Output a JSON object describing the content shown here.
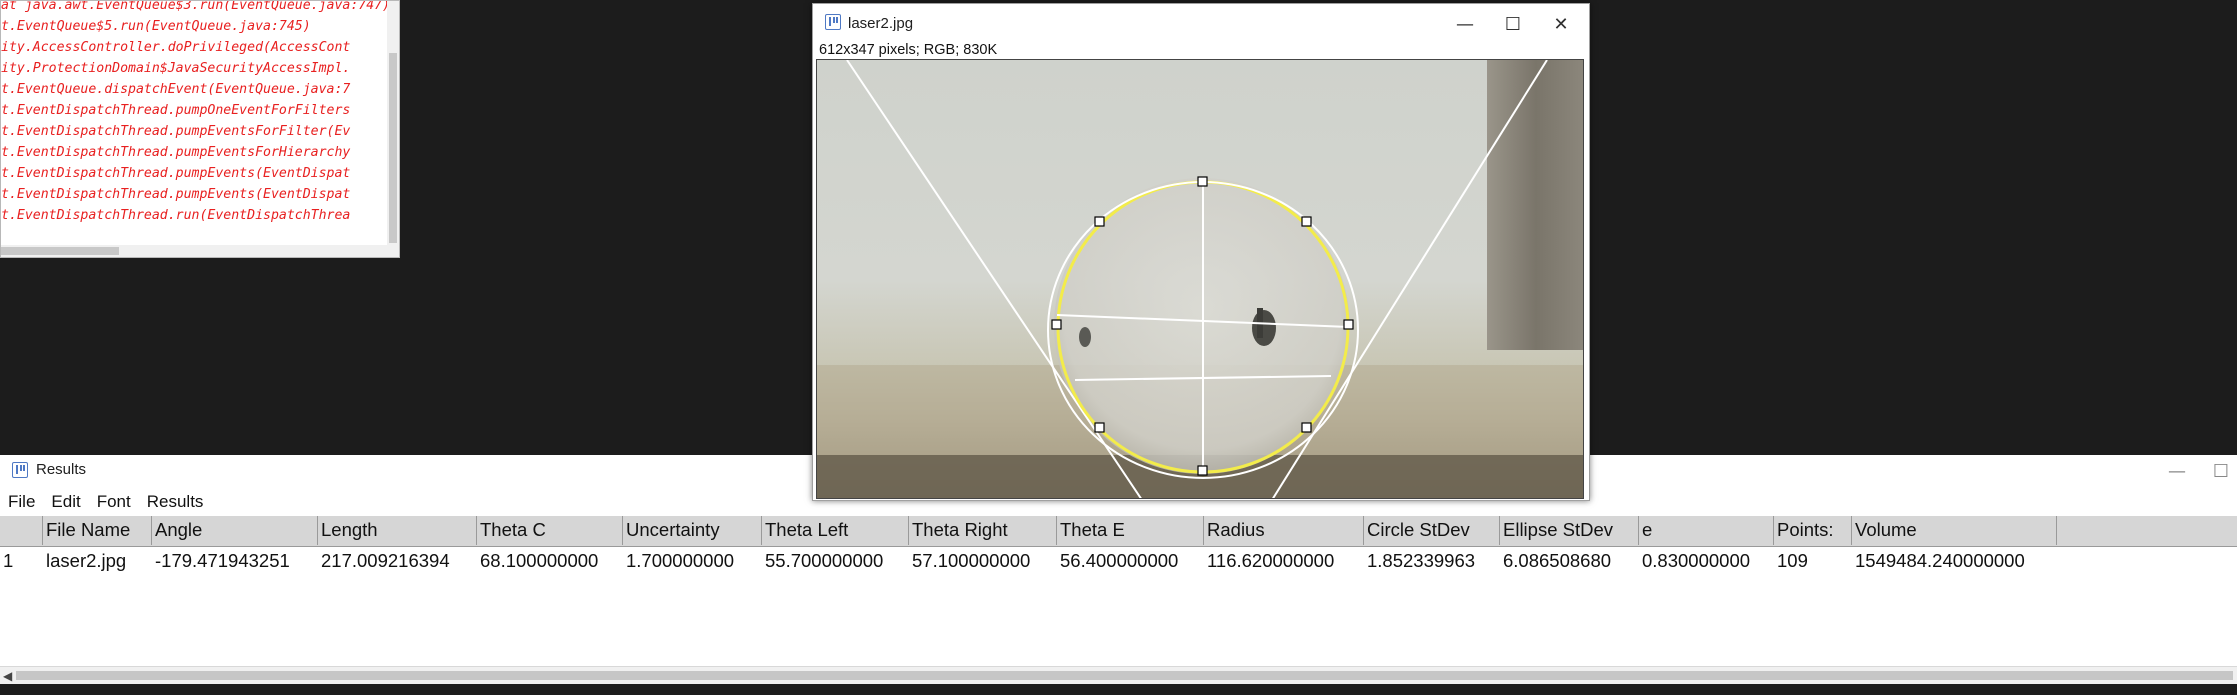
{
  "console": {
    "lines": [
      "at java.awt.EventQueue$3.run(EventQueue.java:747)",
      "t.EventQueue$5.run(EventQueue.java:745)",
      "ity.AccessController.doPrivileged(AccessCont",
      "ity.ProtectionDomain$JavaSecurityAccessImpl.",
      "t.EventQueue.dispatchEvent(EventQueue.java:7",
      "t.EventDispatchThread.pumpOneEventForFilters",
      "t.EventDispatchThread.pumpEventsForFilter(Ev",
      "t.EventDispatchThread.pumpEventsForHierarchy",
      "t.EventDispatchThread.pumpEvents(EventDispat",
      "t.EventDispatchThread.pumpEvents(EventDispat",
      "t.EventDispatchThread.run(EventDispatchThrea"
    ]
  },
  "image_window": {
    "title": "laser2.jpg",
    "info": "612x347 pixels; RGB; 830K",
    "minimize": "—",
    "maximize": "☐",
    "close": "✕"
  },
  "results": {
    "title": "Results",
    "menu": [
      "File",
      "Edit",
      "Font",
      "Results"
    ],
    "columns": [
      " ",
      "File Name",
      "Angle",
      "Length",
      "Theta C",
      "Uncertainty",
      "Theta Left",
      "Theta Right",
      "Theta E",
      "Radius",
      "Circle StDev",
      "Ellipse StDev",
      "e",
      "Points:",
      "Volume"
    ],
    "row": [
      "1",
      "laser2.jpg",
      "-179.471943251",
      "217.009216394",
      "68.100000000",
      "1.700000000",
      "55.700000000",
      "57.100000000",
      "56.400000000",
      "116.620000000",
      "1.852339963",
      "6.086508680",
      "0.830000000",
      "109",
      "1549484.240000000"
    ],
    "minimize": "—",
    "maximize": "☐"
  },
  "colors": {
    "console_text": "#e82020",
    "overlay_circle": "#f3ec4a",
    "overlay_lines": "#ffffff",
    "desktop": "#1c1c1c"
  }
}
